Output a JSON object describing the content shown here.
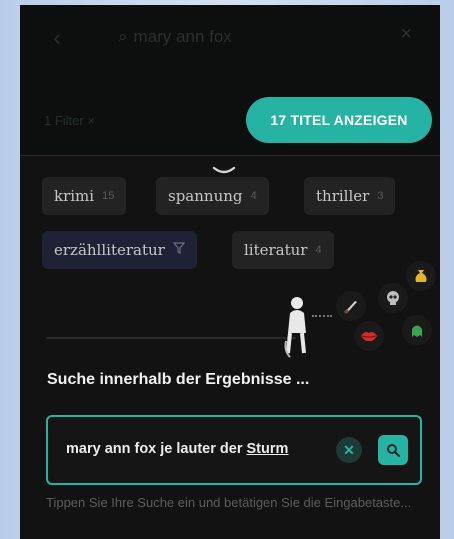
{
  "header": {
    "back_icon": "chevron-left-icon",
    "query": "mary ann fox",
    "close_icon": "close-icon",
    "dim_line_1": "1 Filter ×",
    "dim_line_2": ""
  },
  "show_results_label": "17 TITEL ANZEIGEN",
  "tags": [
    {
      "label": "krimi",
      "count": "15",
      "active": false
    },
    {
      "label": "spannung",
      "count": "4",
      "active": false
    },
    {
      "label": "thriller",
      "count": "3",
      "active": false
    },
    {
      "label": "erzählliteratur",
      "count": "",
      "active": true
    },
    {
      "label": "literatur",
      "count": "4",
      "active": false
    }
  ],
  "filter_icon": "filter-icon",
  "mood_icons": [
    "knife-icon",
    "skull-icon",
    "money-bag-icon",
    "lips-icon",
    "ghost-icon"
  ],
  "search_section": {
    "title": "Suche innerhalb der Ergebnisse ...",
    "value_main": "mary ann fox je lauter der ",
    "value_underlined": "Sturm",
    "clear_icon": "clear-icon",
    "search_icon": "search-icon",
    "hint": "Tippen Sie Ihre Suche ein und betätigen Sie die Eingabetaste..."
  },
  "colors": {
    "accent": "#27b3a3",
    "background": "#121212",
    "chip": "#232323",
    "chip_active": "#1f2235"
  }
}
